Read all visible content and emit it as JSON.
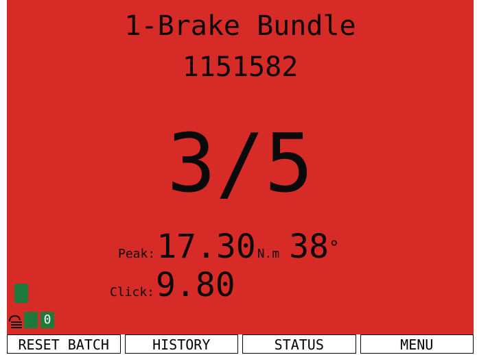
{
  "screen": {
    "background": "#d62b27",
    "title": "1-Brake Bundle",
    "serial": "1151582",
    "count": "3/5"
  },
  "readings": {
    "peak_label": "Peak:",
    "peak_value": "17.30",
    "peak_unit": "N.m",
    "angle_value": "38",
    "angle_unit": "°",
    "click_label": "Click:",
    "click_value": "9.80"
  },
  "status": {
    "indicator_color": "#1e7a3a",
    "lock_icon": "lock-icon",
    "counter": "0"
  },
  "softkeys": [
    {
      "label": "RESET BATCH"
    },
    {
      "label": "HISTORY"
    },
    {
      "label": "STATUS"
    },
    {
      "label": "MENU"
    }
  ]
}
